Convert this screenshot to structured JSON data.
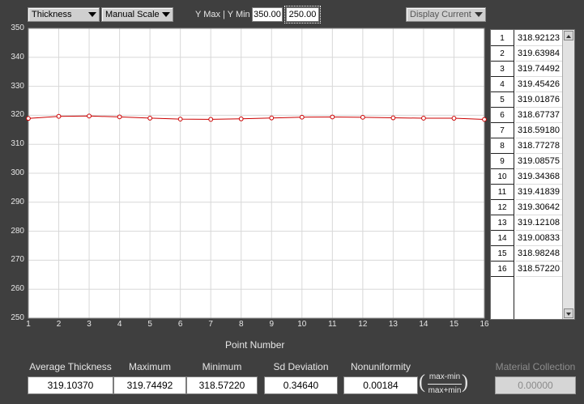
{
  "toolbar": {
    "measure_select": "Thickness",
    "scale_select": "Manual Scale",
    "ymax_ymin_label": "Y Max | Y Min",
    "ymax_value": "350.00",
    "ymin_value": "250.00",
    "display_select": "Display Current"
  },
  "chart_data": {
    "type": "line",
    "xlabel": "Point Number",
    "ylabel": "",
    "ylim": [
      250,
      350
    ],
    "xlim": [
      1,
      16
    ],
    "x": [
      1,
      2,
      3,
      4,
      5,
      6,
      7,
      8,
      9,
      10,
      11,
      12,
      13,
      14,
      15,
      16
    ],
    "values": [
      318.92123,
      319.63984,
      319.74492,
      319.45426,
      319.01876,
      318.67737,
      318.5918,
      318.77278,
      319.08575,
      319.34368,
      319.41839,
      319.30642,
      319.12108,
      319.00833,
      318.98248,
      318.5722
    ],
    "y_ticks": [
      "250",
      "260",
      "270",
      "280",
      "290",
      "300",
      "310",
      "320",
      "330",
      "340",
      "350"
    ],
    "x_ticks": [
      "1",
      "2",
      "3",
      "4",
      "5",
      "6",
      "7",
      "8",
      "9",
      "10",
      "11",
      "12",
      "13",
      "14",
      "15",
      "16"
    ],
    "grid": true,
    "line_color": "#cc0000",
    "marker_color": "#cc0000"
  },
  "table": {
    "rows": [
      {
        "idx": "1",
        "val": "318.92123"
      },
      {
        "idx": "2",
        "val": "319.63984"
      },
      {
        "idx": "3",
        "val": "319.74492"
      },
      {
        "idx": "4",
        "val": "319.45426"
      },
      {
        "idx": "5",
        "val": "319.01876"
      },
      {
        "idx": "6",
        "val": "318.67737"
      },
      {
        "idx": "7",
        "val": "318.59180"
      },
      {
        "idx": "8",
        "val": "318.77278"
      },
      {
        "idx": "9",
        "val": "319.08575"
      },
      {
        "idx": "10",
        "val": "319.34368"
      },
      {
        "idx": "11",
        "val": "319.41839"
      },
      {
        "idx": "12",
        "val": "319.30642"
      },
      {
        "idx": "13",
        "val": "319.12108"
      },
      {
        "idx": "14",
        "val": "319.00833"
      },
      {
        "idx": "15",
        "val": "318.98248"
      },
      {
        "idx": "16",
        "val": "318.57220"
      }
    ]
  },
  "stats": {
    "average_label": "Average Thickness",
    "average_value": "319.10370",
    "maximum_label": "Maximum",
    "maximum_value": "319.74492",
    "minimum_label": "Minimum",
    "minimum_value": "318.57220",
    "sd_label": "Sd Deviation",
    "sd_value": "0.34640",
    "nonuni_label": "Nonuniformity",
    "nonuni_value": "0.00184",
    "frac_num": "max-min",
    "frac_den": "max+min",
    "paren_open": "(",
    "paren_close": ")"
  },
  "material": {
    "label": "Material Collection",
    "value": "0.00000"
  },
  "colors": {
    "background": "#3f3f3f",
    "plot_background": "#ffffff",
    "grid": "#d8d8d8"
  }
}
